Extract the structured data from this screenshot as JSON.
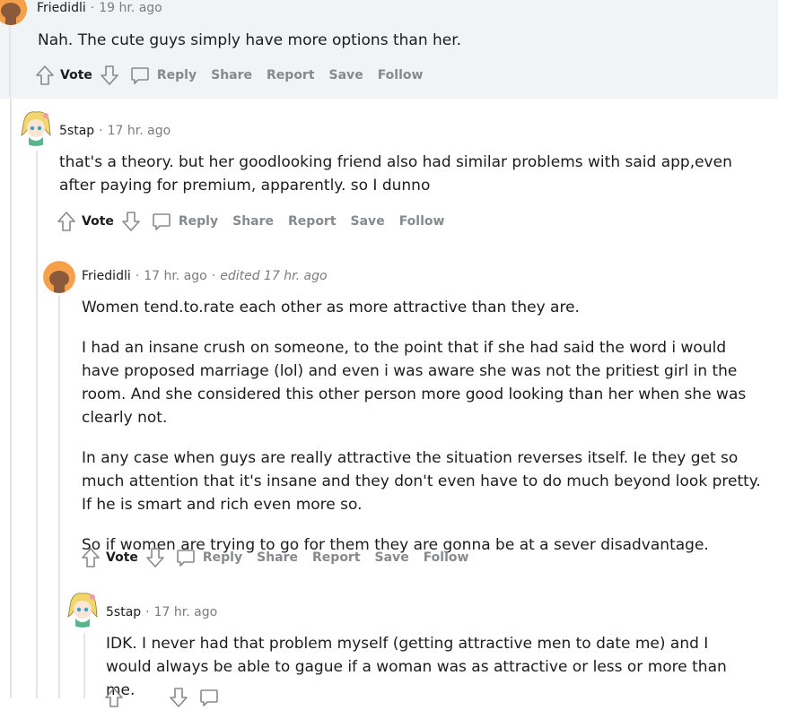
{
  "actions": {
    "vote": "Vote",
    "reply": "Reply",
    "share": "Share",
    "report": "Report",
    "save": "Save",
    "follow": "Follow"
  },
  "comments": [
    {
      "author": "Friedidli",
      "time": "19 hr. ago",
      "paragraphs": [
        "Nah. The cute guys simply have more options than her."
      ]
    },
    {
      "author": "5stap",
      "time": "17 hr. ago",
      "paragraphs": [
        "that's a theory. but her goodlooking friend also had similar problems with said app,even after paying for premium, apparently. so I dunno"
      ]
    },
    {
      "author": "Friedidli",
      "time": "17 hr. ago",
      "edited": "edited 17 hr. ago",
      "paragraphs": [
        "Women tend.to.rate each other as more attractive than they are.",
        "I had an insane crush on someone, to the point that if she had said the word i would have proposed marriage (lol) and even i was aware she was not the pritiest girl in the room. And she considered this other person more good looking than her when she was clearly not.",
        "In any case when guys are really attractive the situation reverses itself. Ie they get so much attention that it's insane and they don't even have to do much beyond look pretty. If he is smart and rich even more so.",
        "So if women are trying to go for them they are gonna be at a sever disadvantage."
      ]
    },
    {
      "author": "5stap",
      "time": "17 hr. ago",
      "paragraphs": [
        "IDK. I never had that problem myself (getting attractive men to date me) and I would always be able to gague if a woman was as attractive or less or more than me."
      ]
    }
  ],
  "colors": {
    "highlight_bg": "#f1f4f7",
    "thread_line": "#e3e5e8",
    "meta_gray": "#7c7c7c",
    "action_gray": "#878a8c",
    "avatar_orange": "#f6a14a"
  }
}
